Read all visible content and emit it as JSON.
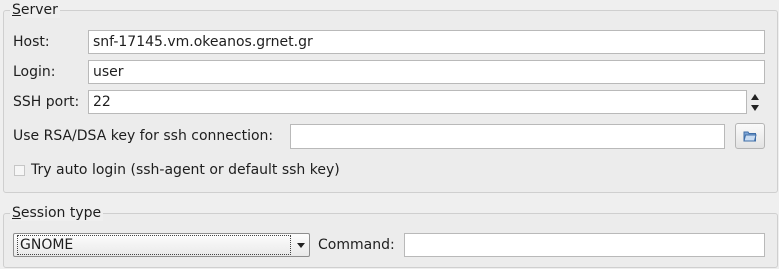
{
  "server": {
    "title_first": "S",
    "title_rest": "erver",
    "host_label": "Host:",
    "host_value": "snf-17145.vm.okeanos.grnet.gr",
    "login_label": "Login:",
    "login_value": "user",
    "ssh_port_label": "SSH port:",
    "ssh_port_value": "22",
    "rsa_label": "Use RSA/DSA key for ssh connection:",
    "rsa_value": "",
    "auto_login_label": "Try auto login (ssh-agent or default ssh key)",
    "auto_login_checked": false
  },
  "session": {
    "title_first": "S",
    "title_rest": "ession type",
    "type_value": "GNOME",
    "command_label": "Command:",
    "command_value": ""
  },
  "icons": {
    "spin": "spin-arrows-icon",
    "browse": "folder-open-icon",
    "combo": "chevron-down-icon"
  }
}
